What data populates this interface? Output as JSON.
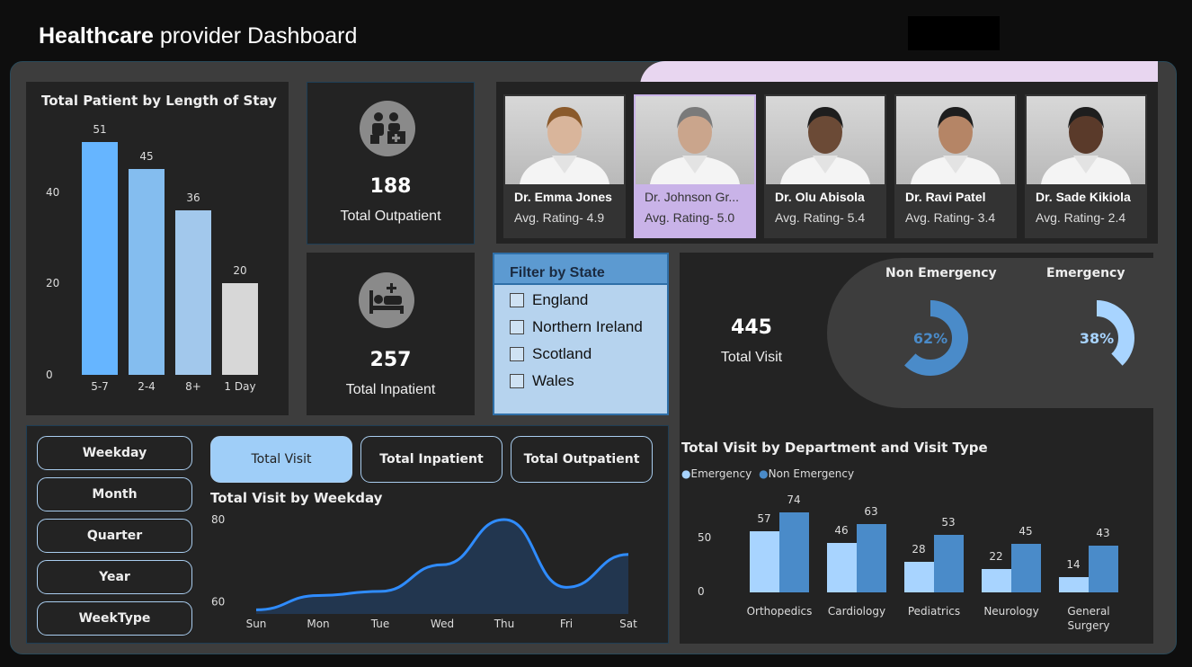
{
  "header": {
    "title_bold": "Healthcare",
    "title_rest": "provider Dashboard"
  },
  "los_chart": {
    "title": "Total Patient by Length of Stay",
    "chart_data": {
      "type": "bar",
      "categories": [
        "5-7",
        "2-4",
        "8+",
        "1 Day"
      ],
      "values": [
        51,
        45,
        36,
        20
      ],
      "yticks": [
        "0",
        "20",
        "40"
      ],
      "ylim": [
        0,
        60
      ],
      "colors": [
        "#66b5ff",
        "#84bdef",
        "#a2c8ec",
        "#d7d7d7"
      ]
    }
  },
  "kpis": {
    "outpatient": {
      "value": "188",
      "label": "Total Outpatient"
    },
    "inpatient": {
      "value": "257",
      "label": "Total Inpatient"
    },
    "visits": {
      "value": "445",
      "label": "Total Visit"
    }
  },
  "doctors": [
    {
      "name": "Dr. Emma Jones",
      "rating": "Avg. Rating- 4.9",
      "selected": false
    },
    {
      "name": "Dr. Johnson Gr...",
      "rating": "Avg. Rating- 5.0",
      "selected": true
    },
    {
      "name": "Dr. Olu Abisola",
      "rating": "Avg. Rating- 5.4",
      "selected": false
    },
    {
      "name": "Dr. Ravi Patel",
      "rating": "Avg. Rating- 3.4",
      "selected": false
    },
    {
      "name": "Dr. Sade Kikiola",
      "rating": "Avg. Rating- 2.4",
      "selected": false
    }
  ],
  "filter": {
    "title": "Filter by State",
    "items": [
      "England",
      "Northern Ireland",
      "Scotland",
      "Wales"
    ]
  },
  "donuts": {
    "non_emergency": {
      "label": "Non Emergency",
      "pct": "62%",
      "value": 62,
      "color": "#4a8bc9"
    },
    "emergency": {
      "label": "Emergency",
      "pct": "38%",
      "value": 38,
      "color": "#a8d4ff"
    }
  },
  "toggles": [
    "Weekday",
    "Month",
    "Quarter",
    "Year",
    "WeekType"
  ],
  "metric_buttons": [
    "Total Visit",
    "Total Inpatient",
    "Total Outpatient"
  ],
  "weekday_chart": {
    "title": "Total Visit by Weekday",
    "chart_data": {
      "type": "area",
      "categories": [
        "Sun",
        "Mon",
        "Tue",
        "Wed",
        "Thu",
        "Fri",
        "Sat"
      ],
      "values": [
        58,
        61.5,
        62.5,
        69,
        80,
        63.5,
        71.5
      ],
      "yticks": [
        "60",
        "80"
      ],
      "ylim": [
        57,
        80
      ]
    }
  },
  "dept_chart": {
    "title": "Total Visit by Department and Visit Type",
    "legend": [
      "Emergency",
      "Non Emergency"
    ],
    "chart_data": {
      "type": "bar",
      "categories": [
        "Orthopedics",
        "Cardiology",
        "Pediatrics",
        "Neurology",
        "General Surgery"
      ],
      "series": [
        {
          "name": "Emergency",
          "values": [
            57,
            46,
            28,
            22,
            14
          ],
          "color": "#a8d4ff"
        },
        {
          "name": "Non Emergency",
          "values": [
            74,
            63,
            53,
            45,
            43
          ],
          "color": "#4a8bc9"
        }
      ],
      "yticks": [
        "0",
        "50"
      ],
      "ylim": [
        0,
        80
      ]
    }
  }
}
